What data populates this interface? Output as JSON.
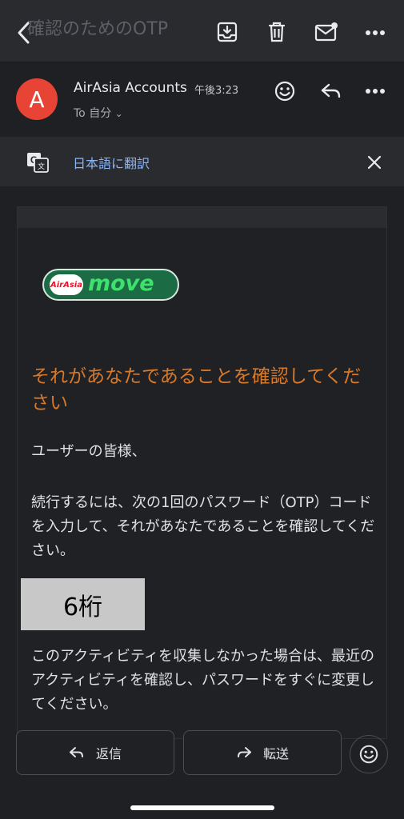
{
  "header": {
    "subject_partial": "確認のためのOTP",
    "icons": [
      "back-icon",
      "archive-icon",
      "trash-icon",
      "mark-unread-icon",
      "more-icon"
    ]
  },
  "sender": {
    "avatar_letter": "A",
    "name": "AirAsia Accounts",
    "time": "午後3:23",
    "to_label": "To 自分"
  },
  "translate": {
    "label": "日本語に翻訳"
  },
  "email": {
    "logo_small": "AirAsia",
    "logo_main": "move",
    "heading": "それがあなたであることを確認してください",
    "greeting": "ユーザーの皆様、",
    "paragraph1": "続行するには、次の1回のパスワード（OTP）コードを入力して、それがあなたであることを確認してください。",
    "otp_placeholder": "6桁",
    "paragraph2": "このアクティビティを収集しなかった場合は、最近のアクティビティを確認し、パスワードをすぐに変更してください。"
  },
  "actions": {
    "reply_label": "返信",
    "forward_label": "転送"
  },
  "colors": {
    "background": "#1f2023",
    "link_blue": "#8ab4f8",
    "heading_orange": "#d8792a",
    "avatar_red": "#e84435",
    "logo_green": "#1b6b45"
  }
}
